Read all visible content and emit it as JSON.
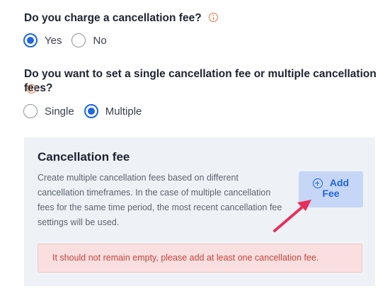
{
  "q1": {
    "text": "Do you charge a cancellation fee?",
    "info_icon": "info-icon",
    "options": [
      {
        "label": "Yes",
        "checked": true
      },
      {
        "label": "No",
        "checked": false
      }
    ]
  },
  "q2": {
    "text": "Do you want to set a single cancellation fee or multiple cancellation fees?",
    "info_icon": "info-icon",
    "options": [
      {
        "label": "Single",
        "checked": false
      },
      {
        "label": "Multiple",
        "checked": true
      }
    ]
  },
  "panel": {
    "title": "Cancellation fee",
    "description": "Create multiple cancellation fees based on different cancellation timeframes. In the case of multiple cancellation fees for the same time period, the most recent cancellation fee settings will be used.",
    "add_button": {
      "label_line1": "Add",
      "label_line2": "Fee",
      "icon": "plus-circle-icon"
    },
    "error": "It should not remain empty, please add at least one cancellation fee."
  },
  "colors": {
    "accent": "#1f66e0",
    "info": "#e0703a",
    "error_text": "#c4453f",
    "error_bg": "#f9dfdf",
    "panel_bg": "#eef2f7",
    "arrow": "#e8305a"
  }
}
